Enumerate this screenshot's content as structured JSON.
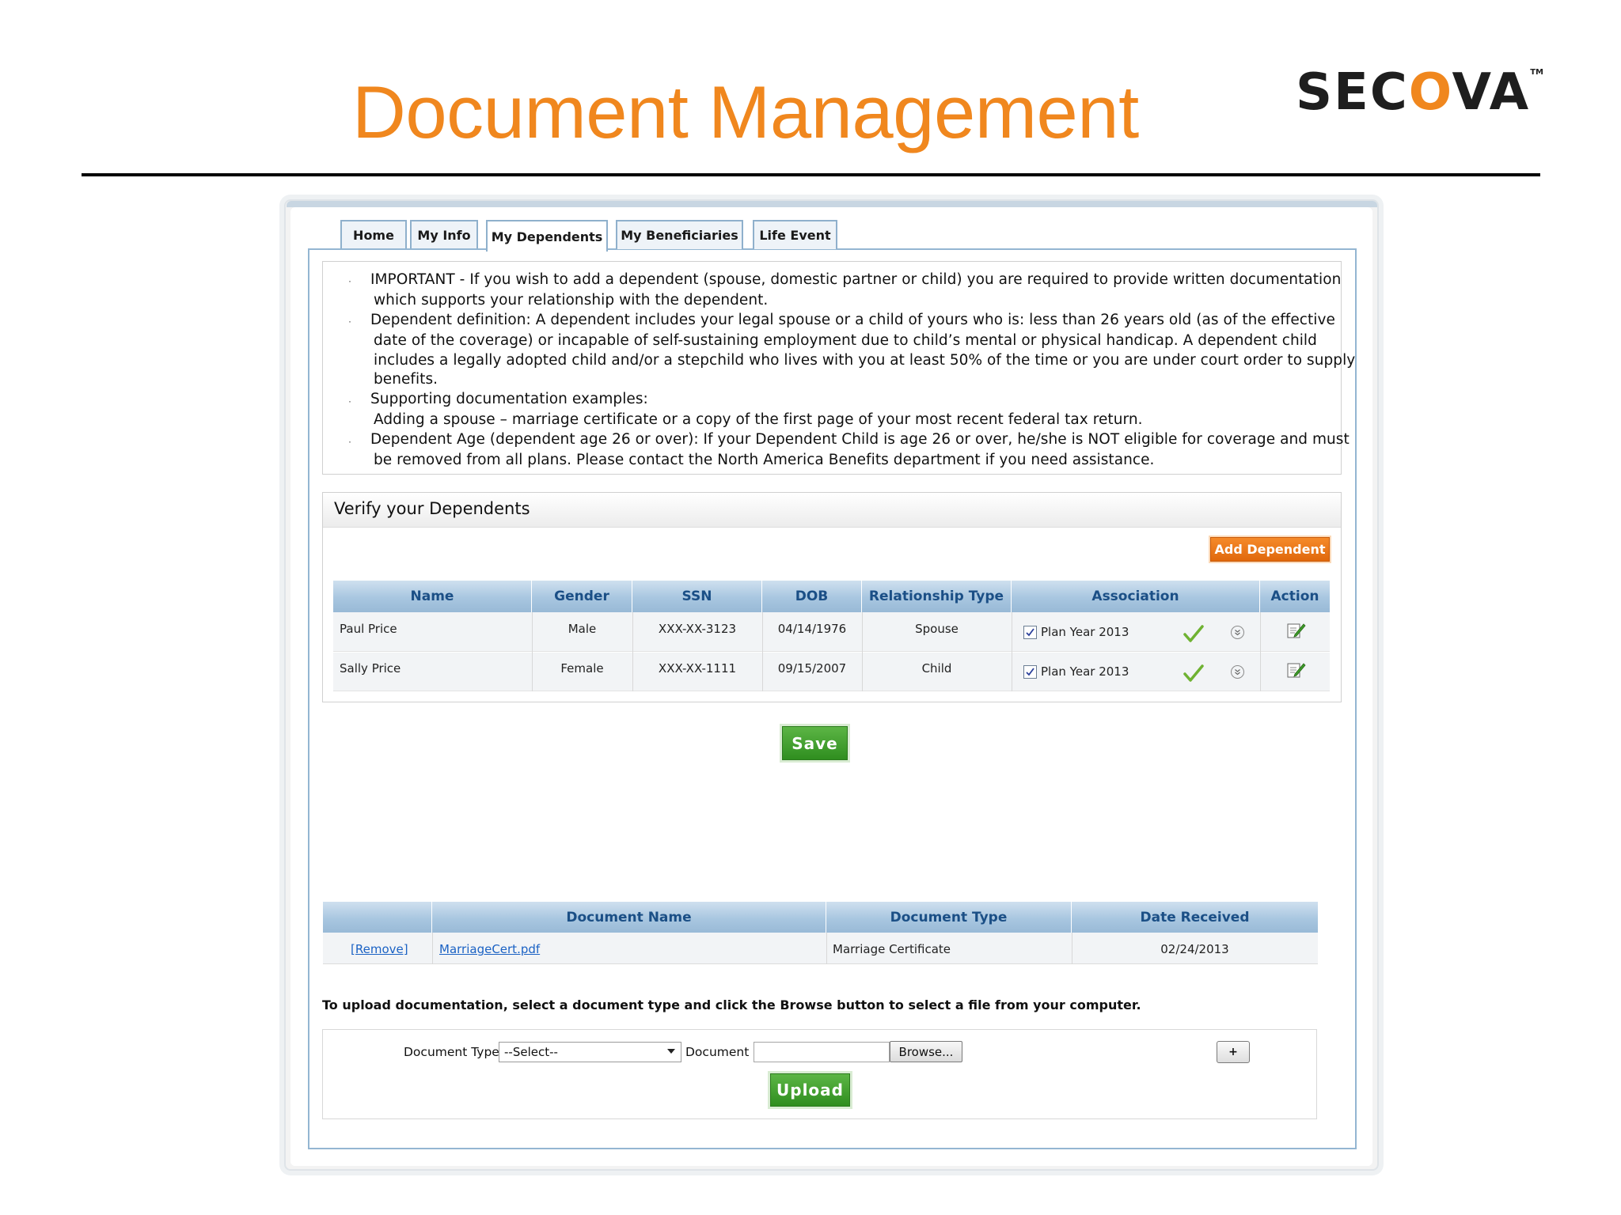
{
  "slide": {
    "title": "Document Management",
    "logo": {
      "left": "SEC",
      "accent": "O",
      "right": "VA",
      "tm": "TM"
    }
  },
  "tabs": [
    {
      "label": "Home"
    },
    {
      "label": "My Info"
    },
    {
      "label": "My Dependents",
      "active": true
    },
    {
      "label": "My Beneficiaries"
    },
    {
      "label": "Life Event"
    }
  ],
  "info": {
    "lines": [
      "IMPORTANT - If you wish to add a dependent (spouse, domestic partner or child) you are required to provide written documentation",
      "which supports your relationship with the dependent.",
      "Dependent definition:  A dependent includes your legal spouse or a child of yours who is: less than 26 years old (as of the effective",
      "date of the coverage) or incapable of self-sustaining employment due to child’s mental or physical handicap. A dependent child",
      "includes a legally adopted child and/or a stepchild who lives with you at least 50% of the time or you are under court order to supply",
      "benefits.",
      "Supporting documentation examples:",
      "Adding a spouse – marriage certificate or a copy of the first page of your most recent federal tax return.",
      "Dependent Age (dependent age 26 or over):  If your Dependent Child is age 26 or over, he/she is NOT eligible for coverage and must",
      "be removed from all plans. Please contact the North America Benefits department if you need assistance."
    ],
    "bullet": "·"
  },
  "verify": {
    "title": "Verify your Dependents",
    "add_button": "Add Dependent",
    "columns": [
      "Name",
      "Gender",
      "SSN",
      "DOB",
      "Relationship Type",
      "Association",
      "Action"
    ],
    "rows": [
      {
        "name": "Paul Price",
        "gender": "Male",
        "ssn": "XXX-XX-3123",
        "dob": "04/14/1976",
        "relationship": "Spouse",
        "association": "Plan Year 2013"
      },
      {
        "name": "Sally Price",
        "gender": "Female",
        "ssn": "XXX-XX-1111",
        "dob": "09/15/2007",
        "relationship": "Child",
        "association": "Plan Year 2013"
      }
    ],
    "save_button": "Save"
  },
  "documents": {
    "columns": [
      "",
      "Document Name",
      "Document Type",
      "Date Received"
    ],
    "rows": [
      {
        "remove": "[Remove]",
        "name": "MarriageCert.pdf",
        "type": "Marriage Certificate",
        "date": "02/24/2013"
      }
    ]
  },
  "upload": {
    "note": "To upload documentation, select a document type and click the Browse button to select a file from your computer.",
    "doc_type_label": "Document Type:",
    "doc_type_value": "--Select--",
    "document_label": "Document :",
    "browse_button": "Browse...",
    "plus_button": "+",
    "upload_button": "Upload"
  },
  "colors": {
    "title_orange": "#f0871e",
    "tab_border": "#8fb0cc",
    "header_blue": "#1b4f86",
    "add_orange": "#e0680c",
    "save_green": "#3c9a2a",
    "link_blue": "#1b62c4"
  }
}
